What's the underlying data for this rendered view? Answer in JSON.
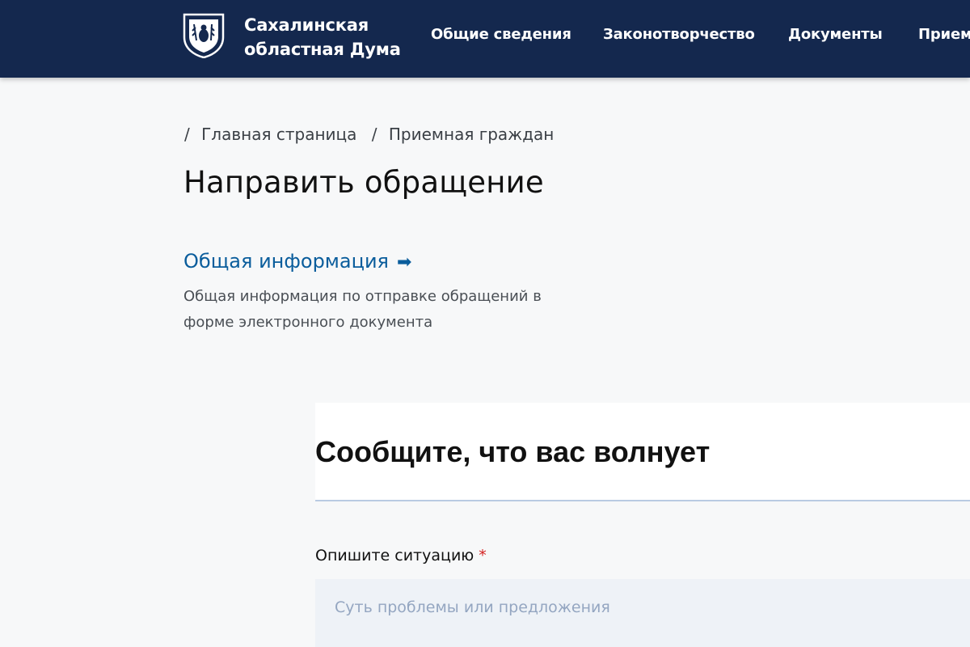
{
  "header": {
    "org_name_line1": "Сахалинская",
    "org_name_line2": "областная Дума",
    "logo_icon": "coat-of-arms-icon",
    "background_color": "#14284e",
    "nav": [
      {
        "label": "Общие сведения"
      },
      {
        "label": "Законотворчество"
      },
      {
        "label": "Документы"
      },
      {
        "label": "Прием"
      }
    ]
  },
  "breadcrumb": {
    "separator": "/",
    "items": [
      {
        "label": "Главная страница"
      },
      {
        "label": "Приемная граждан"
      }
    ]
  },
  "page": {
    "title": "Направить обращение",
    "info_link_label": "Общая информация",
    "info_link_icon": "arrow-right-icon",
    "info_description": "Общая информация по отправке обращений в форме электронного документа",
    "link_color": "#0a5d9c"
  },
  "form": {
    "title": "Сообщите, что вас волнует",
    "situation_label": "Опишите ситуацию",
    "required_mark": "*",
    "situation_placeholder": "Суть проблемы или предложения",
    "situation_value": ""
  }
}
